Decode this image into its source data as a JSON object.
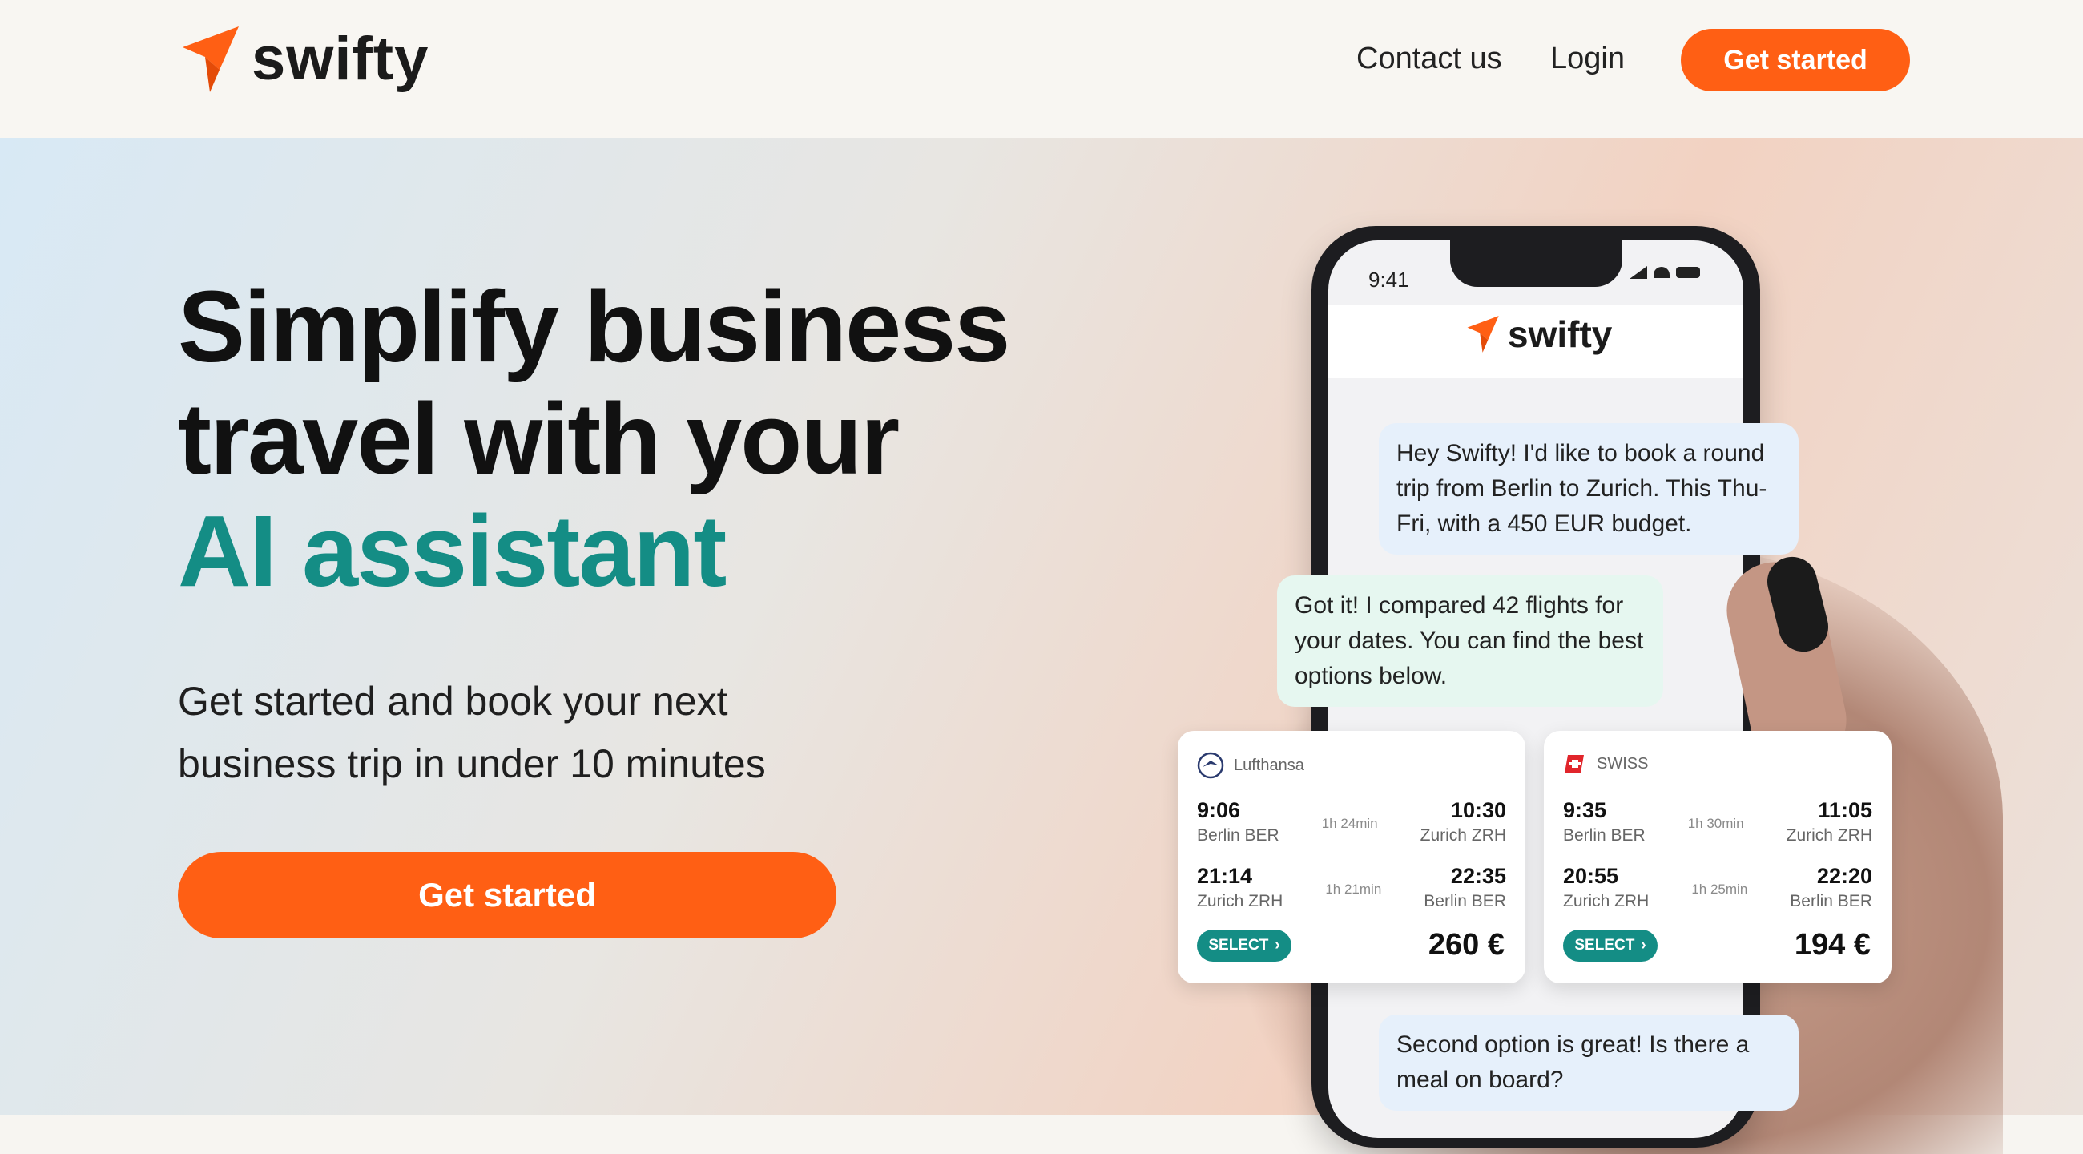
{
  "brand": {
    "name": "swifty",
    "accent": "#ff5f14",
    "teal": "#148d85"
  },
  "nav": {
    "contact": "Contact us",
    "login": "Login",
    "cta": "Get started"
  },
  "hero": {
    "line1": "Simplify business",
    "line2": "travel with your",
    "line3": "AI assistant",
    "sub1": "Get started and book your next",
    "sub2": "business trip in under 10 minutes",
    "cta": "Get started"
  },
  "phone": {
    "status_time": "9:41",
    "messages": [
      "Hey Swifty! I'd like to book a round trip from Berlin to Zurich. This Thu-Fri, with a 450 EUR budget.",
      "Got it! I compared 42 flights for your dates. You can find the best options below.",
      "Second option is great! Is there a meal on board?"
    ],
    "cards": [
      {
        "airline": "Lufthansa",
        "out": {
          "dep_time": "9:06",
          "dep": "Berlin BER",
          "dur": "1h 24min",
          "arr_time": "10:30",
          "arr": "Zurich ZRH"
        },
        "ret": {
          "dep_time": "21:14",
          "dep": "Zurich ZRH",
          "dur": "1h 21min",
          "arr_time": "22:35",
          "arr": "Berlin BER"
        },
        "select": "SELECT",
        "price": "260 €"
      },
      {
        "airline": "SWISS",
        "out": {
          "dep_time": "9:35",
          "dep": "Berlin BER",
          "dur": "1h 30min",
          "arr_time": "11:05",
          "arr": "Zurich ZRH"
        },
        "ret": {
          "dep_time": "20:55",
          "dep": "Zurich ZRH",
          "dur": "1h 25min",
          "arr_time": "22:20",
          "arr": "Berlin BER"
        },
        "select": "SELECT",
        "price": "194 €"
      }
    ]
  }
}
